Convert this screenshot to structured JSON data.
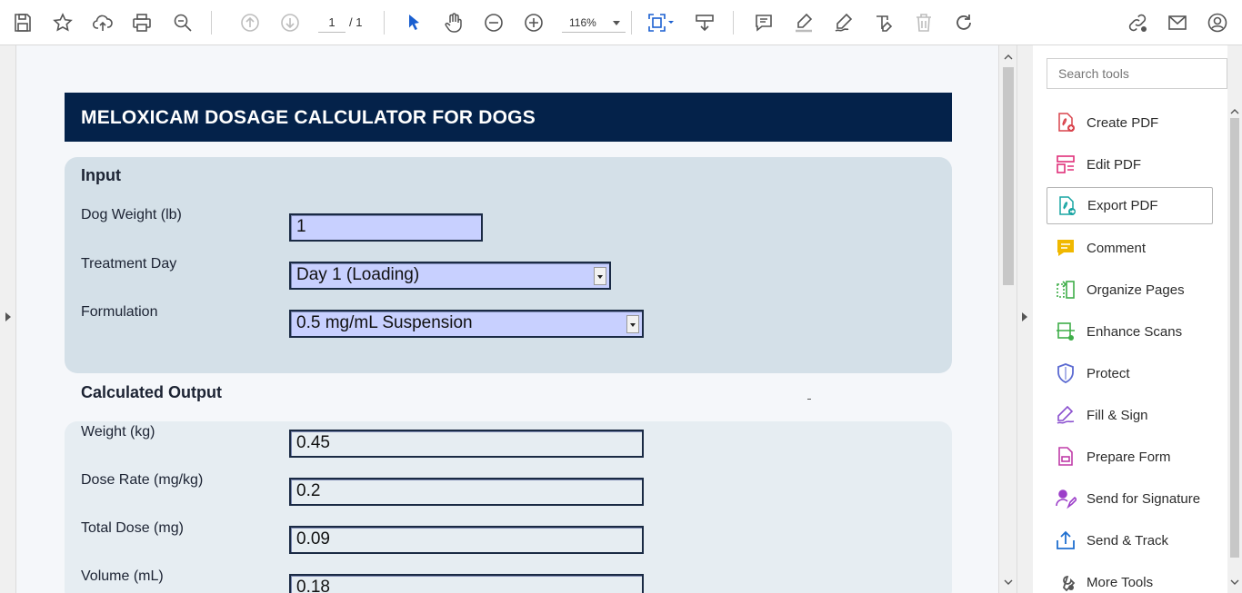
{
  "toolbar": {
    "page_current": "1",
    "page_total": "/ 1",
    "zoom": "116%",
    "icons": [
      "save-icon",
      "bookmark-star-icon",
      "upload-cloud-icon",
      "print-icon",
      "search-zoom-icon",
      "page-up-icon",
      "page-down-icon",
      "select-cursor-icon",
      "hand-icon",
      "zoom-out-icon",
      "zoom-in-icon",
      "fit-page-icon",
      "scroll-mode-icon",
      "comment-icon",
      "highlight-icon",
      "sign-pen-icon",
      "edit-text-icon",
      "delete-icon",
      "rotate-icon",
      "share-link-icon",
      "email-icon",
      "account-icon"
    ]
  },
  "document": {
    "title": "MELOXICAM DOSAGE CALCULATOR FOR DOGS",
    "input_section": {
      "heading": "Input",
      "weight_label": "Dog Weight (lb)",
      "weight_value": "1",
      "day_label": "Treatment Day",
      "day_value": "Day 1 (Loading)",
      "formulation_label": "Formulation",
      "formulation_value": "0.5 mg/mL Suspension"
    },
    "output_section": {
      "heading": "Calculated Output",
      "weight_kg_label": "Weight (kg)",
      "weight_kg_value": "0.45",
      "dose_rate_label": "Dose Rate (mg/kg)",
      "dose_rate_value": "0.2",
      "total_dose_label": "Total Dose (mg)",
      "total_dose_value": "0.09",
      "volume_label": "Volume (mL)",
      "volume_value": "0.18"
    }
  },
  "tools_pane": {
    "search_placeholder": "Search tools",
    "items": [
      {
        "label": "Create PDF",
        "color": "#d9434c"
      },
      {
        "label": "Edit PDF",
        "color": "#e0307a"
      },
      {
        "label": "Export PDF",
        "color": "#19a5a3"
      },
      {
        "label": "Comment",
        "color": "#f0b800"
      },
      {
        "label": "Organize Pages",
        "color": "#3fae49"
      },
      {
        "label": "Enhance Scans",
        "color": "#3fae49"
      },
      {
        "label": "Protect",
        "color": "#5b6ad1"
      },
      {
        "label": "Fill & Sign",
        "color": "#8a4fcf"
      },
      {
        "label": "Prepare Form",
        "color": "#c03ca8"
      },
      {
        "label": "Send for Signature",
        "color": "#9c3fc9"
      },
      {
        "label": "Send & Track",
        "color": "#1f6fd0"
      },
      {
        "label": "More Tools",
        "color": "#555555"
      }
    ]
  }
}
